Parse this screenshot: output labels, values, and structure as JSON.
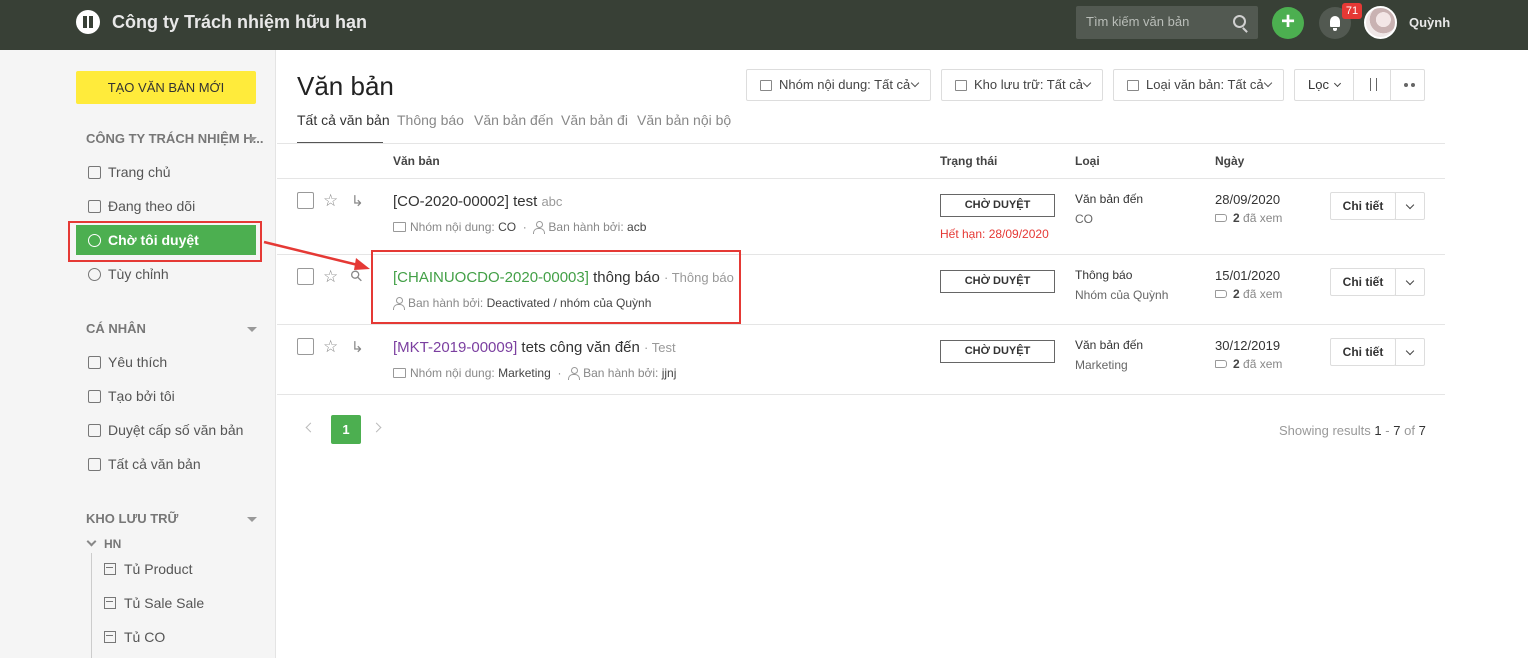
{
  "header": {
    "company": "Công ty Trách nhiệm hữu hạn",
    "search_placeholder": "Tìm kiếm văn bản",
    "add_label": "+",
    "notification_count": "71",
    "username": "Quỳnh"
  },
  "sidebar": {
    "create_button": "TẠO VĂN BẢN MỚI",
    "section_company": "CÔNG TY TRÁCH NHIỆM H...",
    "company_items": [
      {
        "label": "Trang chủ",
        "icon": "grid-icon"
      },
      {
        "label": "Đang theo dõi",
        "icon": "chart-icon"
      },
      {
        "label": "Chờ tôi duyệt",
        "icon": "clock-icon"
      },
      {
        "label": "Tùy chỉnh",
        "icon": "gear-icon"
      }
    ],
    "section_personal": "CÁ NHÂN",
    "personal_items": [
      {
        "label": "Yêu thích",
        "icon": "star-doc-icon"
      },
      {
        "label": "Tạo bởi tôi",
        "icon": "doc-icon"
      },
      {
        "label": "Duyệt cấp số văn bản",
        "icon": "copy-icon"
      },
      {
        "label": "Tất cả văn bản",
        "icon": "asterisk-icon"
      }
    ],
    "section_storage": "KHO LƯU TRỮ",
    "storage_group": "HN",
    "storage_items": [
      "Tủ Product",
      "Tủ Sale Sale",
      "Tủ CO"
    ]
  },
  "main": {
    "title": "Văn bản",
    "filters": {
      "content_group": "Nhóm nội dung: Tất cả",
      "storage": "Kho lưu trữ: Tất cả",
      "doc_type": "Loại văn bản: Tất cả",
      "filter_label": "Lọc"
    },
    "tabs": [
      "Tất cả văn bản",
      "Thông báo",
      "Văn bản đến",
      "Văn bản đi",
      "Văn bản nội bộ"
    ],
    "columns": {
      "doc": "Văn bản",
      "status": "Trạng thái",
      "type": "Loại",
      "date": "Ngày"
    },
    "rows": [
      {
        "code": "[CO-2020-00002]",
        "name": "test",
        "type_tag": "abc",
        "meta1_label": "Nhóm nội dung:",
        "meta1_value": "CO",
        "sep": "·",
        "meta2_label": "Ban hành bởi:",
        "meta2_value": "acb",
        "status": "CHỜ DUYỆT",
        "expire": "Hết hạn: 28/09/2020",
        "type": "Văn bản đến",
        "type_sub": "CO",
        "date": "28/09/2020",
        "seen_count": "2",
        "seen_label": "đã xem",
        "detail": "Chi tiết"
      },
      {
        "code": "[CHAINUOCDO-2020-00003]",
        "name": "thông báo",
        "type_tag": "· Thông báo",
        "meta2_label": "Ban hành bởi:",
        "meta2_value": "Deactivated / nhóm của Quỳnh",
        "status": "CHỜ DUYỆT",
        "type": "Thông báo",
        "type_sub": "Nhóm của Quỳnh",
        "date": "15/01/2020",
        "seen_count": "2",
        "seen_label": "đã xem",
        "detail": "Chi tiết"
      },
      {
        "code": "[MKT-2019-00009]",
        "name": "tets công văn đến",
        "type_tag": "· Test",
        "meta1_label": "Nhóm nội dung:",
        "meta1_value": "Marketing",
        "sep": "·",
        "meta2_label": "Ban hành bởi:",
        "meta2_value": "jjnj",
        "status": "CHỜ DUYỆT",
        "type": "Văn bản đến",
        "type_sub": "Marketing",
        "date": "30/12/2019",
        "seen_count": "2",
        "seen_label": "đã xem",
        "detail": "Chi tiết"
      }
    ],
    "pagination": {
      "current": "1"
    },
    "results": {
      "prefix": "Showing results",
      "from": "1",
      "dash": "-",
      "to": "7",
      "of": "of",
      "total": "7"
    }
  }
}
